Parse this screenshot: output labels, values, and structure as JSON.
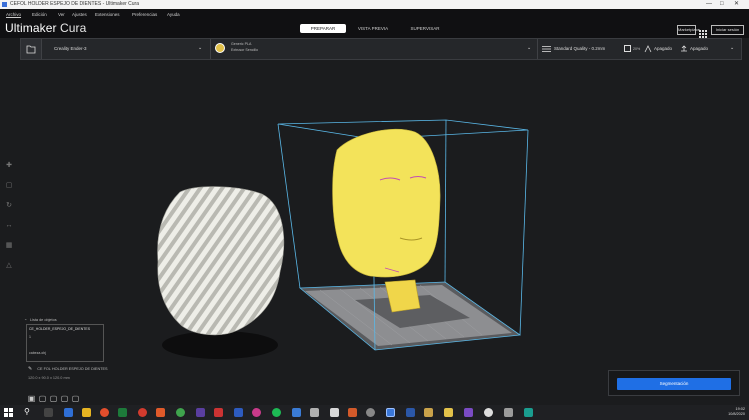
{
  "window": {
    "title": "CEFOL HOLDER ESPEJO DE DIENTES - Ultimaker Cura",
    "controls": [
      "—",
      "□",
      "✕"
    ]
  },
  "menu": [
    "Archivo",
    "Edición",
    "Ver",
    "Ajustes",
    "Extensiones",
    "Preferencias",
    "Ayuda"
  ],
  "header": {
    "logo_bold": "Ultimaker",
    "logo_light": " Cura",
    "stages": [
      {
        "label": "PREPARAR",
        "active": true
      },
      {
        "label": "VISTA PREVIA",
        "active": false
      },
      {
        "label": "SUPERVISAR",
        "active": false
      }
    ],
    "marketplace_label": "Marketplace",
    "signin_label": "Iniciar sesión"
  },
  "toolbar": {
    "printer_name": "Creality Ender-3",
    "material_line1": "Generic PLA",
    "material_line2": "Extrusor Sencillo",
    "profile_text": "Standard Quality - 0.2mm",
    "support_label": "Apagado",
    "adhesion_label": "Apagado",
    "support_pct": "20%"
  },
  "object_list": {
    "header": "Lista de objetos",
    "rows": [
      "CE_HOLDER_ESPEJO_DE_DIENTES",
      "1",
      "",
      "cabeza.obj"
    ]
  },
  "bottom_info": {
    "filename": "CE FOL HOLDER ESPEJO DE DIENTES",
    "dimensions": "120.0 x 90.0 x 120.0 mm"
  },
  "view_icons": [
    "cube-3d",
    "cube-front",
    "cube-top",
    "cube-left",
    "cube-right"
  ],
  "slice_button": "Segmentación",
  "clock": {
    "time": "19:02",
    "date": "10/8/2020"
  },
  "colors": {
    "accent": "#1f6fe5",
    "model_yellow": "#f3e35a",
    "model_white": "#e8e8e2",
    "build_volume": "#5ab8e8"
  }
}
